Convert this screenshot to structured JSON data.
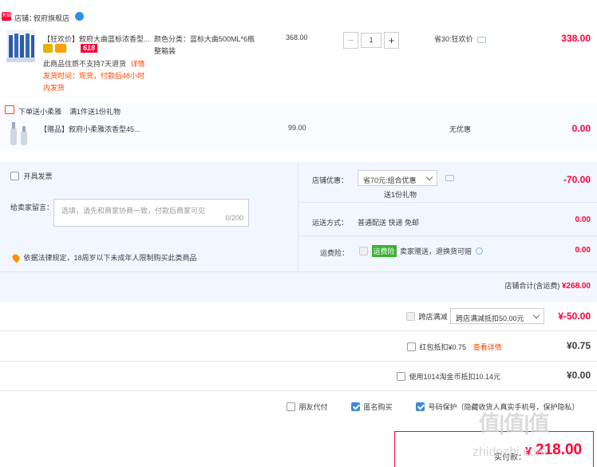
{
  "shop": {
    "icon": "tmall-shop-icon",
    "label": "店铺：",
    "name": "叙府旗舰店",
    "chat_icon": "wangwang-chat-icon"
  },
  "item1": {
    "tag": "【狂欢价】",
    "title": "叙府大曲蓝标浓香型...",
    "badge_618": "618",
    "sku_label": "颜色分类：",
    "sku_value_line1": "蓝标大曲500ML*6瓶",
    "sku_value_line2": "整箱装",
    "notice": "此商品住质不支持7天退货",
    "notice_link": "详情",
    "ship_line1": "发货时间：现货，付款后48小时",
    "ship_line2": "内发货",
    "price": "368.00",
    "qty": "1",
    "minus": "−",
    "plus": "+",
    "promo": "省30:狂欢价",
    "subtotal": "338.00"
  },
  "gift": {
    "icon": "gift-icon",
    "title": "下单送小柔雅",
    "rule": "满1件送1份礼物",
    "tag": "【赠品】",
    "name": "叙府小柔雅浓香型45...",
    "price": "99.00",
    "promo": "无优惠",
    "subtotal": "0.00"
  },
  "invoice": {
    "label": "开具发票"
  },
  "message": {
    "label": "给卖家留言：",
    "placeholder": "选填，请先和商家协商一致，付款后商家可见",
    "counter": "0/200"
  },
  "legal": {
    "text": "依据法律规定，18周岁以下未成年人限制购买此类商品"
  },
  "discount": {
    "label": "店铺优惠：",
    "select_value": "省70元:组合优惠",
    "sub": "送1份礼物",
    "amount": "-70.00"
  },
  "shipping": {
    "label": "运送方式：",
    "value": "普通配送 快递 免邮",
    "amount": "0.00"
  },
  "insurance": {
    "label": "运费险：",
    "badge": "运费险",
    "text": "卖家赠送，退换货可赔",
    "amount": "0.00"
  },
  "shop_total": {
    "label": "店铺合计(含运费)",
    "amount": "¥268.00"
  },
  "cross_store": {
    "label": "跨店满减",
    "select_value": "跨店满减抵扣50.00元",
    "amount": "¥-50.00"
  },
  "red_packet": {
    "label": "红包抵扣¥0.75",
    "link": "查看详情",
    "amount": "¥0.75"
  },
  "taojinbi": {
    "label": "使用1014淘金币抵扣10.14元",
    "amount": "¥0.00"
  },
  "options": {
    "friend_pay": "朋友代付",
    "anonymous": "匿名购买",
    "number_protect": "号码保护（隐藏收货人真实手机号，保护隐私）"
  },
  "pay": {
    "label": "实付款：",
    "currency": "¥",
    "amount": "218.00"
  },
  "watermark": {
    "logo": "值|值|值",
    "url": "zhidezhi.com"
  },
  "colors": {
    "accent_red": "#ff0036",
    "orange": "#ff4400",
    "panel_blue": "#f2f7ff",
    "row_blue": "#f8fbff"
  }
}
